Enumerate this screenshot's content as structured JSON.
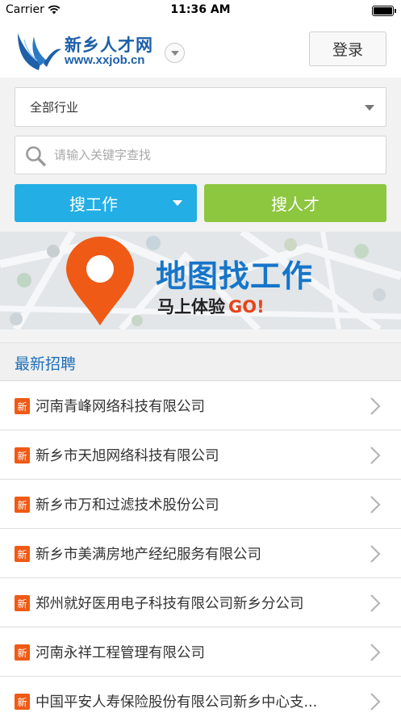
{
  "status_bar": {
    "carrier": "Carrier",
    "time": "11:36 AM"
  },
  "header": {
    "logo_title": "新乡人才网",
    "logo_url": "www.xxjob.cn",
    "login_label": "登录"
  },
  "search": {
    "industry_value": "全部行业",
    "keyword_placeholder": "请输入关键字查找",
    "search_job_label": "搜工作",
    "search_talent_label": "搜人才"
  },
  "banner": {
    "title": "地图找工作",
    "subtitle": "马上体验",
    "go": "GO!"
  },
  "latest": {
    "title": "最新招聘",
    "badge": "新",
    "items": [
      {
        "name": "河南青峰网络科技有限公司"
      },
      {
        "name": "新乡市天旭网络科技有限公司"
      },
      {
        "name": "新乡市万和过滤技术股份公司"
      },
      {
        "name": "新乡市美满房地产经纪服务有限公司"
      },
      {
        "name": "郑州就好医用电子科技有限公司新乡分公司"
      },
      {
        "name": "河南永祥工程管理有限公司"
      },
      {
        "name": "中国平安人寿保险股份有限公司新乡中心支..."
      }
    ]
  },
  "colors": {
    "brand_blue": "#1d5fa9",
    "search_job_blue": "#23aee5",
    "search_talent_green": "#8dc63f",
    "badge_orange": "#ef5a16",
    "pin_orange": "#ef5a16"
  },
  "icons": [
    "wifi-icon",
    "battery-icon",
    "wings-logo-icon",
    "chevron-down-icon",
    "search-icon",
    "map-pin-icon",
    "chevron-right-icon"
  ]
}
